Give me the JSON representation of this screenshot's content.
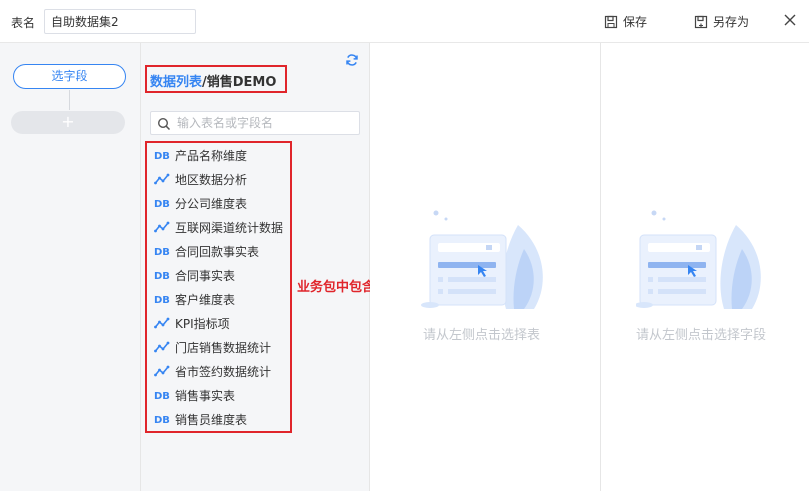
{
  "header": {
    "name_label": "表名",
    "name_value": "自助数据集2",
    "save_label": "保存",
    "save_as_label": "另存为"
  },
  "left": {
    "select_field_label": "选字段",
    "add_label": "+"
  },
  "middle": {
    "breadcrumb_link": "数据列表",
    "breadcrumb_sep": "/",
    "breadcrumb_current": "销售DEMO",
    "search_placeholder": "输入表名或字段名",
    "tables": [
      {
        "label": "产品名称维度",
        "icon": "db-table-icon"
      },
      {
        "label": "地区数据分析",
        "icon": "analysis-table-icon"
      },
      {
        "label": "分公司维度表",
        "icon": "db-table-icon"
      },
      {
        "label": "互联网渠道统计数据",
        "icon": "analysis-table-icon"
      },
      {
        "label": "合同回款事实表",
        "icon": "db-table-icon"
      },
      {
        "label": "合同事实表",
        "icon": "db-table-icon"
      },
      {
        "label": "客户维度表",
        "icon": "db-table-icon"
      },
      {
        "label": "KPI指标项",
        "icon": "analysis-table-icon"
      },
      {
        "label": "门店销售数据统计",
        "icon": "analysis-table-icon"
      },
      {
        "label": "省市签约数据统计",
        "icon": "analysis-table-icon"
      },
      {
        "label": "销售事实表",
        "icon": "db-table-icon"
      },
      {
        "label": "销售员维度表",
        "icon": "db-table-icon"
      }
    ],
    "annotation": "业务包中包含的表"
  },
  "panels": {
    "select_table_hint": "请从左侧点击选择表",
    "select_field_hint": "请从左侧点击选择字段"
  },
  "colors": {
    "accent": "#3685f2",
    "highlight_red": "#e0252b"
  }
}
